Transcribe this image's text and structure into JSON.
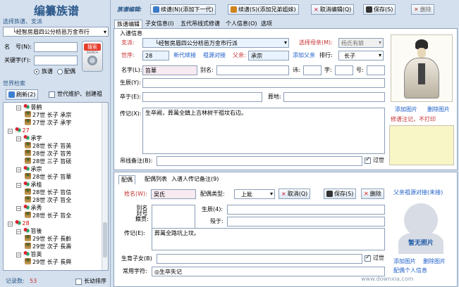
{
  "app": {
    "title": "编纂族谱"
  },
  "toolbar": {
    "label": "族谱编辑:",
    "continue_next": "续谱(N)(添加下一代)",
    "continue_sibling": "续谱(S)(添加兄弟姐妹)",
    "cancel": "取消编辑(Q)",
    "save": "保存(S)",
    "delete": "删除"
  },
  "left": {
    "select_label": "选择族谱、支派",
    "select_value": "└经智房眉四公分枋邑万金市行",
    "name_label": "名　号(N):",
    "key_label": "关键字(F):",
    "search_label": "搜索",
    "search_sub": "SEARCH",
    "radio_clan": "族谱",
    "radio_spouse": "配偶",
    "tree_title": "世界检索",
    "refresh": "刷新(2)",
    "check_maint": "世代维护、创建祖",
    "tree": [
      {
        "indent": 1,
        "type": "gen",
        "text": "罾鹤",
        "pm": "−"
      },
      {
        "indent": 2,
        "type": "person",
        "text": "27世 长子 承宗"
      },
      {
        "indent": 2,
        "type": "person",
        "text": "27世 次子 承宇"
      },
      {
        "indent": 0,
        "type": "gen",
        "text": "27",
        "pm": "−"
      },
      {
        "indent": 1,
        "type": "gen",
        "text": "承宇",
        "pm": "−"
      },
      {
        "indent": 2,
        "type": "person",
        "text": "28世 长子 笞英"
      },
      {
        "indent": 2,
        "type": "person",
        "text": "28世 次子 笞芳"
      },
      {
        "indent": 2,
        "type": "person",
        "text": "28世 三子 笞硕"
      },
      {
        "indent": 1,
        "type": "gen",
        "text": "承宗",
        "pm": "−"
      },
      {
        "indent": 2,
        "type": "person",
        "text": "28世 长子 笞華"
      },
      {
        "indent": 1,
        "type": "gen",
        "text": "承桂",
        "pm": "−"
      },
      {
        "indent": 2,
        "type": "person",
        "text": "28世 长子 笞信"
      },
      {
        "indent": 2,
        "type": "person",
        "text": "28世 次子 笞全"
      },
      {
        "indent": 1,
        "type": "gen",
        "text": "承秀",
        "pm": "−"
      },
      {
        "indent": 2,
        "type": "person",
        "text": "28世 长子 笞全"
      },
      {
        "indent": 0,
        "type": "gen",
        "text": "28",
        "pm": "−"
      },
      {
        "indent": 1,
        "type": "gen",
        "text": "笞後",
        "pm": "−"
      },
      {
        "indent": 2,
        "type": "person",
        "text": "29世 长子 長齡"
      },
      {
        "indent": 2,
        "type": "person",
        "text": "29世 次子 長壽"
      },
      {
        "indent": 1,
        "type": "gen",
        "text": "笞英",
        "pm": "−"
      },
      {
        "indent": 2,
        "type": "person",
        "text": "29世 长子 長興"
      }
    ],
    "record_label": "记录数:",
    "record_count": "53",
    "long_sort": "长幼排序"
  },
  "tabs": [
    "族谱编辑",
    "子女信息(I)",
    "五代吊线式修谱",
    "个人信息(O)",
    "选项"
  ],
  "form": {
    "group_label": "入谱信息",
    "branch_label": "支派:",
    "branch_value": "└经智房眉四公分枋邑万金市行派",
    "mother_label": "选择母亲(M):",
    "mother_value": "杨氏有娘",
    "gen_label": "世序:",
    "gen_value": "28",
    "new_link": "新代续接",
    "ancestor_link": "祖源对接",
    "father_label": "父亲:",
    "father_value": "承宗",
    "add_father": "添加父亲",
    "rank_label": "排行:",
    "rank_value": "长子",
    "name_label": "名字(L):",
    "name_value": "笞華",
    "alias_label": "别名:",
    "poem_label": "讳:",
    "zi_label": "字:",
    "hao_label": "号:",
    "birth_label": "生辰(Y):",
    "death_label": "卒于(E):",
    "burial_label": "葬地:",
    "bio_label": "传记(X):",
    "bio_value": "生卒阙，葬萬全鎮上吉林树干祖坟右边。",
    "note_label": "吊线备注(B):",
    "alive_label": "过世",
    "add_photo": "添加图片",
    "del_photo": "删除图片",
    "notice": "修谱注记，不打印"
  },
  "spouse": {
    "tabs": [
      "配偶",
      "配偶列表",
      "入谱人传记备注(9)"
    ],
    "name_label": "姓名(W):",
    "name_value": "吴氏",
    "type_label": "配偶类型:",
    "type_value": "上妣",
    "cancel": "取消(Q)",
    "save": "保存(S)",
    "delete": "删除",
    "link": "父亲祖源对接(未接)",
    "alias_label": "别名\n封号\n籍贯:",
    "birth_label": "生辰(4):",
    "death_label": "殁于:",
    "bio_label": "传记(E):",
    "bio_value": "葬萬全路坑上坟。",
    "children_label": "生育子女(B)",
    "alive_label": "过世",
    "no_photo": "暂无照片",
    "add_photo": "添加图片",
    "del_photo": "删除图片",
    "personal_info": "配偶个人信息"
  },
  "footer": {
    "common_label": "常用字符:",
    "common_value": "◎生卒失记"
  },
  "watermark": "www.downxia.com"
}
